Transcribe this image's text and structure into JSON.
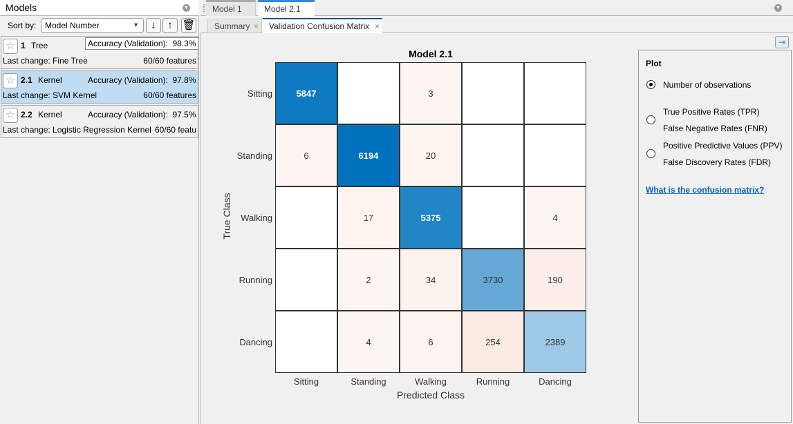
{
  "models_panel": {
    "title": "Models",
    "sort_label": "Sort by:",
    "sort_value": "Model Number",
    "models": [
      {
        "num": "1",
        "type": "Tree",
        "accuracy": "Accuracy (Validation):  98.3%",
        "last_change": "Last change: Fine Tree",
        "features": "60/60 features",
        "selected": false
      },
      {
        "num": "2.1",
        "type": "Kernel",
        "accuracy": "Accuracy (Validation):  97.8%",
        "last_change": "Last change: SVM Kernel",
        "features": "60/60 features",
        "selected": true
      },
      {
        "num": "2.2",
        "type": "Kernel",
        "accuracy": "Accuracy (Validation):  97.5%",
        "last_change": "Last change: Logistic Regression Kernel",
        "features": "60/60 featu",
        "selected": false
      }
    ]
  },
  "doc_tabs": [
    "Model 1",
    "Model 2.1"
  ],
  "sub_tabs": [
    "Summary",
    "Validation Confusion Matrix"
  ],
  "plot_options": {
    "title": "Plot",
    "options": [
      {
        "lines": [
          "Number of observations"
        ],
        "selected": true
      },
      {
        "lines": [
          "True Positive Rates (TPR)",
          "False Negative Rates (FNR)"
        ],
        "selected": false
      },
      {
        "lines": [
          "Positive Predictive Values (PPV)",
          "False Discovery Rates (FDR)"
        ],
        "selected": false
      }
    ],
    "link": "What is the confusion matrix?"
  },
  "colors": {
    "diagonal": "#0072bd",
    "off_diagonal": "#d95319",
    "link": "#0563c1",
    "selected_row": "#bfdcf2"
  },
  "chart_data": {
    "type": "heatmap",
    "title": "Model 2.1",
    "xlabel": "Predicted Class",
    "ylabel": "True Class",
    "classes": [
      "Sitting",
      "Standing",
      "Walking",
      "Running",
      "Dancing"
    ],
    "matrix": [
      [
        5847,
        null,
        3,
        null,
        null
      ],
      [
        6,
        6194,
        20,
        null,
        null
      ],
      [
        null,
        17,
        5375,
        null,
        4
      ],
      [
        null,
        2,
        34,
        3730,
        190
      ],
      [
        null,
        4,
        6,
        254,
        2389
      ]
    ]
  }
}
